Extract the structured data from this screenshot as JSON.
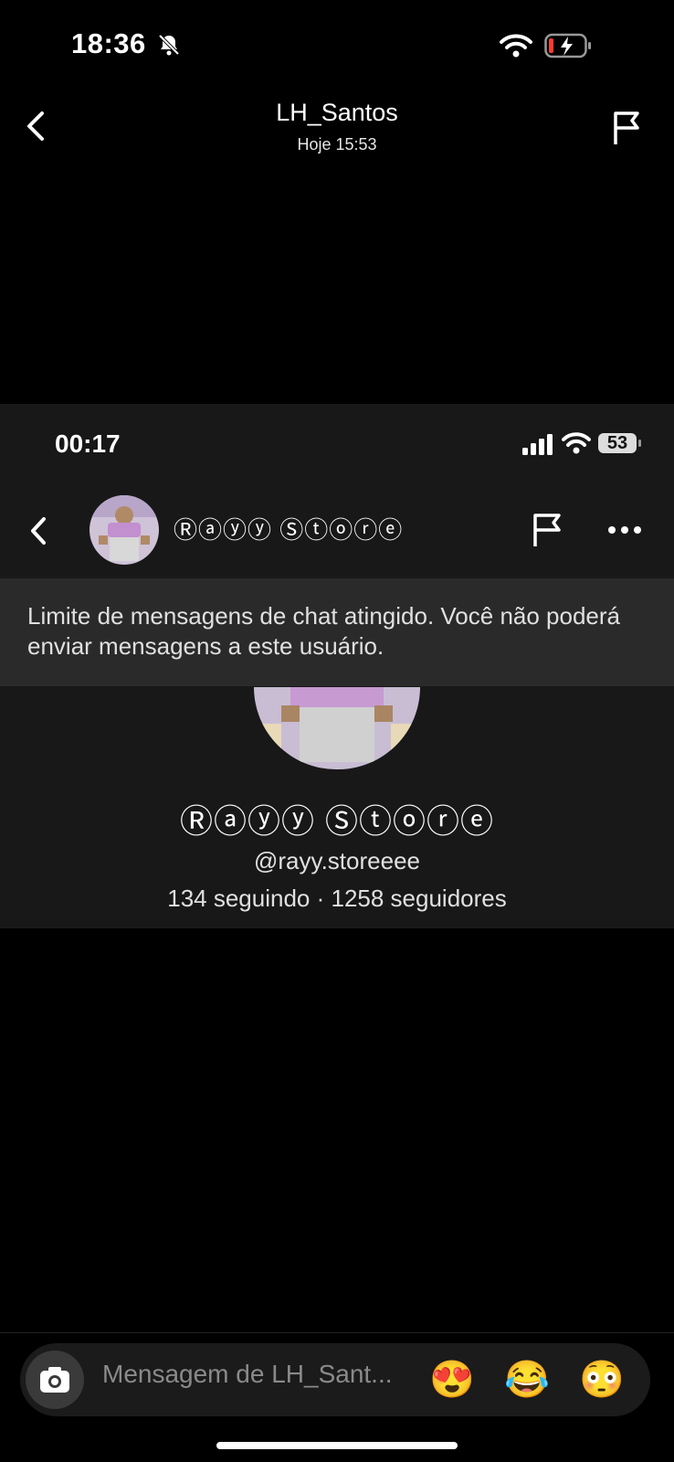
{
  "status_bar": {
    "time": "18:36"
  },
  "header": {
    "title": "LH_Santos",
    "subtitle": "Hoje 15:53"
  },
  "shared_screenshot": {
    "status_time": "00:17",
    "battery_level": "53",
    "chat_header": {
      "name": "Ⓡⓐⓨⓨ Ⓢⓣⓞⓡⓔ"
    },
    "limit_notice": "Limite de mensagens de chat atingido. Você não poderá enviar mensagens a este usuário.",
    "profile": {
      "name": "Ⓡⓐⓨⓨ Ⓢⓣⓞⓡⓔ",
      "handle": "@rayy.storeeee",
      "stats": "134 seguindo · 1258 seguidores"
    }
  },
  "composer": {
    "placeholder": "Mensagem de LH_Sant...",
    "quick_reactions": [
      "😍",
      "😂",
      "😳"
    ]
  },
  "colors": {
    "background": "#000000",
    "card": "#181818",
    "banner": "#2a2a2a"
  }
}
